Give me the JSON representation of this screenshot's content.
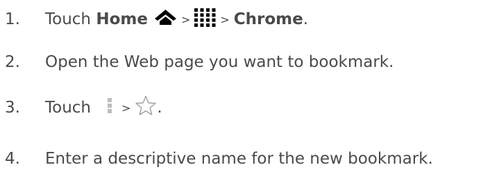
{
  "colors": {
    "text": "#4a4a4a",
    "icon_dark": "#000000",
    "icon_light": "#bdbdbd"
  },
  "steps": [
    {
      "number": "1.",
      "touch": "Touch",
      "home": "Home",
      "sep1": ">",
      "sep2": ">",
      "chrome": "Chrome",
      "end": ".",
      "icons": [
        "home-icon",
        "apps-grid-icon"
      ]
    },
    {
      "number": "2.",
      "text": "Open the Web page you want to bookmark."
    },
    {
      "number": "3.",
      "touch": "Touch",
      "sep": ">",
      "end": ".",
      "icons": [
        "menu-dots-icon",
        "star-outline-icon"
      ]
    },
    {
      "number": "4.",
      "text": "Enter a descriptive name for the new bookmark."
    }
  ]
}
